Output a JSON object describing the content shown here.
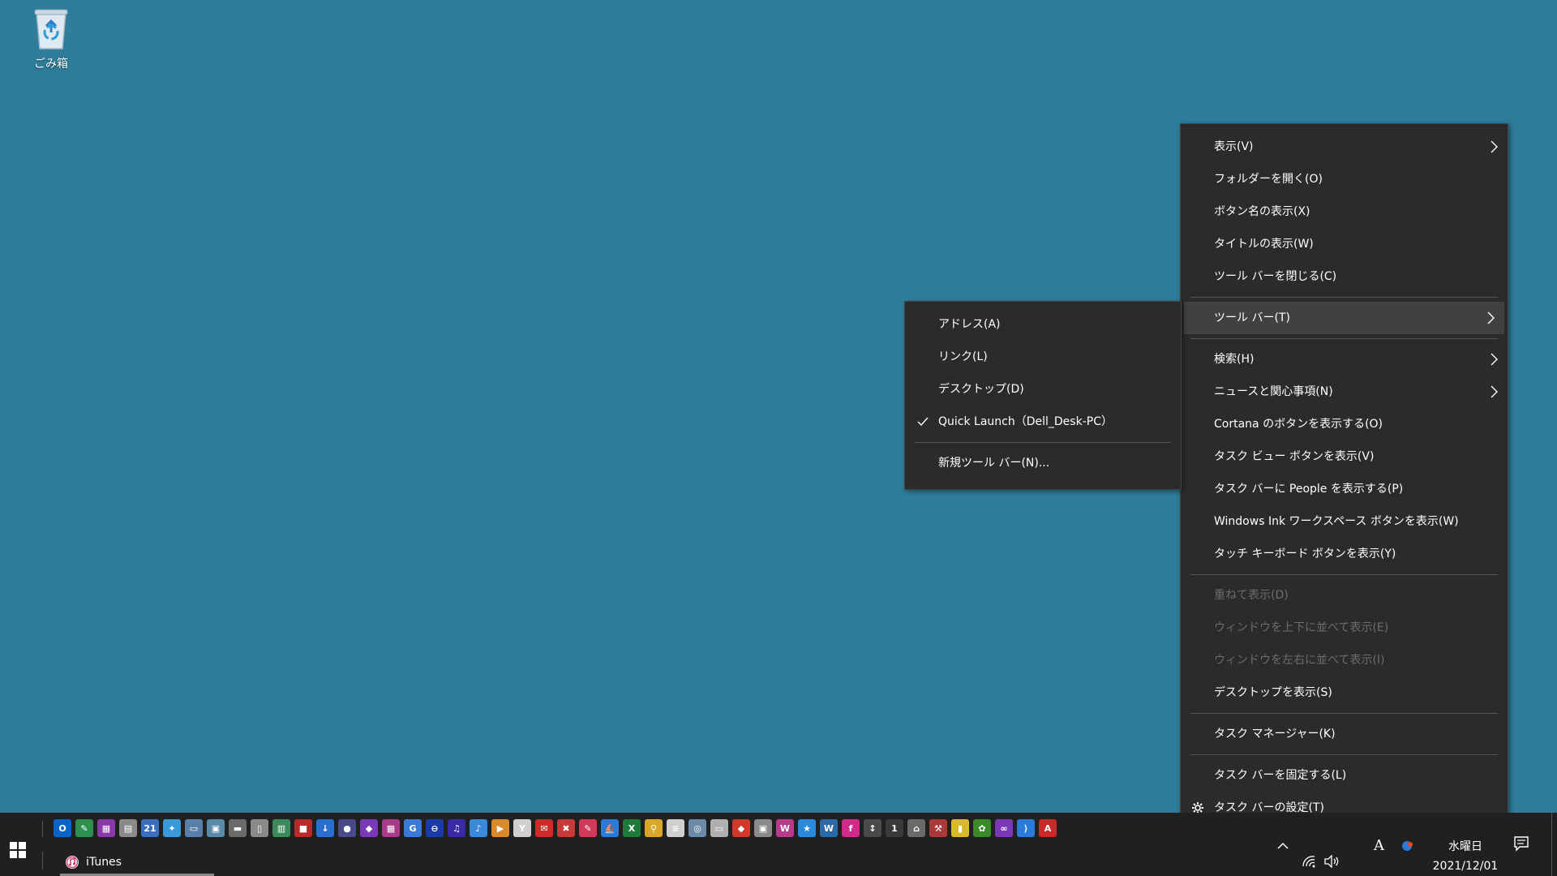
{
  "desktop": {
    "recycle_bin_label": "ごみ箱"
  },
  "main_menu": {
    "items": [
      {
        "label": "表示(V)",
        "submenu": true,
        "disabled": false
      },
      {
        "label": "フォルダーを開く(O)",
        "submenu": false,
        "disabled": false
      },
      {
        "label": "ボタン名の表示(X)",
        "submenu": false,
        "disabled": false
      },
      {
        "label": "タイトルの表示(W)",
        "submenu": false,
        "disabled": false
      },
      {
        "label": "ツール バーを閉じる(C)",
        "submenu": false,
        "disabled": false
      },
      {
        "label": "ツール バー(T)",
        "submenu": true,
        "disabled": false,
        "highlighted": true
      },
      {
        "label": "検索(H)",
        "submenu": true,
        "disabled": false
      },
      {
        "label": "ニュースと関心事項(N)",
        "submenu": true,
        "disabled": false
      },
      {
        "label": "Cortana のボタンを表示する(O)",
        "submenu": false,
        "disabled": false
      },
      {
        "label": "タスク ビュー ボタンを表示(V)",
        "submenu": false,
        "disabled": false
      },
      {
        "label": "タスク バーに People を表示する(P)",
        "submenu": false,
        "disabled": false
      },
      {
        "label": "Windows Ink ワークスペース ボタンを表示(W)",
        "submenu": false,
        "disabled": false
      },
      {
        "label": "タッチ キーボード ボタンを表示(Y)",
        "submenu": false,
        "disabled": false
      },
      {
        "label": "重ねて表示(D)",
        "submenu": false,
        "disabled": true
      },
      {
        "label": "ウィンドウを上下に並べて表示(E)",
        "submenu": false,
        "disabled": true
      },
      {
        "label": "ウィンドウを左右に並べて表示(I)",
        "submenu": false,
        "disabled": true
      },
      {
        "label": "デスクトップを表示(S)",
        "submenu": false,
        "disabled": false
      },
      {
        "label": "タスク マネージャー(K)",
        "submenu": false,
        "disabled": false
      },
      {
        "label": "タスク バーを固定する(L)",
        "submenu": false,
        "disabled": false
      },
      {
        "label": "タスク バーの設定(T)",
        "submenu": false,
        "disabled": false,
        "icon": "gear-icon"
      }
    ]
  },
  "toolbar_submenu": {
    "items": [
      {
        "label": "アドレス(A)",
        "checked": false
      },
      {
        "label": "リンク(L)",
        "checked": false
      },
      {
        "label": "デスクトップ(D)",
        "checked": false
      },
      {
        "label": "Quick Launch（Dell_Desk-PC）",
        "checked": true
      },
      {
        "label": "新規ツール バー(N)...",
        "checked": false
      }
    ]
  },
  "taskbar": {
    "running_app_label": "iTunes",
    "clock_day": "水曜日",
    "clock_date": "2021/12/01",
    "ime_indicator": "A",
    "quick_launch_icons": [
      {
        "name": "outlook-icon",
        "color": "#0a64c8",
        "glyph": "O"
      },
      {
        "name": "notes-icon",
        "color": "#2d8f4e",
        "glyph": "✎"
      },
      {
        "name": "photo-icon",
        "color": "#8a3aa8",
        "glyph": "▦"
      },
      {
        "name": "folder-icon",
        "color": "#8a8a8a",
        "glyph": "▤"
      },
      {
        "name": "calendar-icon",
        "color": "#3a6fbf",
        "glyph": "21"
      },
      {
        "name": "bird-icon",
        "color": "#3a9ad9",
        "glyph": "✦"
      },
      {
        "name": "scanner-icon",
        "color": "#5a7fa8",
        "glyph": "▭"
      },
      {
        "name": "fax-icon",
        "color": "#5a8aa8",
        "glyph": "▣"
      },
      {
        "name": "printer-icon",
        "color": "#6b6b6b",
        "glyph": "▬"
      },
      {
        "name": "file-icon",
        "color": "#8a8a8a",
        "glyph": "▯"
      },
      {
        "name": "chart-tool-icon",
        "color": "#3a8a5a",
        "glyph": "▥"
      },
      {
        "name": "media-icon",
        "color": "#b82a2a",
        "glyph": "■"
      },
      {
        "name": "download-icon",
        "color": "#2a6fd0",
        "glyph": "↓"
      },
      {
        "name": "pin-icon",
        "color": "#4a4a8a",
        "glyph": "●"
      },
      {
        "name": "book-icon",
        "color": "#7a3ab8",
        "glyph": "◆"
      },
      {
        "name": "gallery-icon",
        "color": "#a83a8a",
        "glyph": "▦"
      },
      {
        "name": "google-icon",
        "color": "#3a7ad9",
        "glyph": "G"
      },
      {
        "name": "block-icon",
        "color": "#1a3aa8",
        "glyph": "⊖"
      },
      {
        "name": "music-app-icon",
        "color": "#3a2aa8",
        "glyph": "♫"
      },
      {
        "name": "itunes-icon",
        "color": "#3a8ad9",
        "glyph": "♪"
      },
      {
        "name": "video-icon",
        "color": "#d98a2a",
        "glyph": "▶"
      },
      {
        "name": "yahoo-icon",
        "color": "#d0d0d0",
        "glyph": "Y"
      },
      {
        "name": "mail-icon",
        "color": "#d02a2a",
        "glyph": "✉"
      },
      {
        "name": "tool-red-icon",
        "color": "#c83a3a",
        "glyph": "✖"
      },
      {
        "name": "image-edit-icon",
        "color": "#d03a5a",
        "glyph": "✎"
      },
      {
        "name": "paint-icon",
        "color": "#2a7ad9",
        "glyph": "⛵"
      },
      {
        "name": "excel-icon",
        "color": "#1e7a3a",
        "glyph": "X"
      },
      {
        "name": "key-icon",
        "color": "#d9a82a",
        "glyph": "⚲"
      },
      {
        "name": "document-icon",
        "color": "#d0d0d0",
        "glyph": "≡"
      },
      {
        "name": "network-icon",
        "color": "#6a8aa8",
        "glyph": "◎"
      },
      {
        "name": "monitor-icon",
        "color": "#b0b0b0",
        "glyph": "▭"
      },
      {
        "name": "slides-icon",
        "color": "#d03a2a",
        "glyph": "◆"
      },
      {
        "name": "archive-icon",
        "color": "#8a8a8a",
        "glyph": "▣"
      },
      {
        "name": "w-app-icon",
        "color": "#b83a8a",
        "glyph": "W"
      },
      {
        "name": "star-app-icon",
        "color": "#2a8ad9",
        "glyph": "★"
      },
      {
        "name": "wordpress-icon",
        "color": "#2a6aa8",
        "glyph": "W"
      },
      {
        "name": "font-app-icon",
        "color": "#d02a8a",
        "glyph": "f"
      },
      {
        "name": "ruler-icon",
        "color": "#4a4a4a",
        "glyph": "↕"
      },
      {
        "name": "doc-dark-icon",
        "color": "#3a3a3a",
        "glyph": "1"
      },
      {
        "name": "house-icon",
        "color": "#6a6a6a",
        "glyph": "⌂"
      },
      {
        "name": "hammer-icon",
        "color": "#a83a3a",
        "glyph": "⚒"
      },
      {
        "name": "note-yellow-icon",
        "color": "#d9b82a",
        "glyph": "▮"
      },
      {
        "name": "plant-icon",
        "color": "#3a8a2a",
        "glyph": "✿"
      },
      {
        "name": "visual-studio-icon",
        "color": "#7a3ab8",
        "glyph": "∞"
      },
      {
        "name": "vscode-icon",
        "color": "#2a7ad9",
        "glyph": "⟩"
      },
      {
        "name": "pdf-icon",
        "color": "#c82a2a",
        "glyph": "A"
      }
    ]
  }
}
